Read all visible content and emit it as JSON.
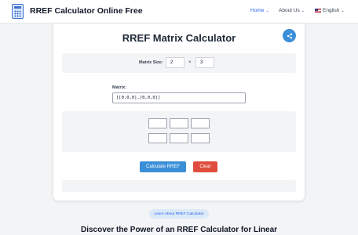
{
  "header": {
    "brand": "RREF Calculator Online Free",
    "brand_icon": "calculator-icon",
    "nav": {
      "home": "Home",
      "about": "About Us",
      "language": "English"
    }
  },
  "calculator": {
    "title": "RREF Matrix Calculator",
    "share_icon": "share-icon",
    "size_label": "Matrix Size:",
    "rows": "2",
    "times": "×",
    "cols": "3",
    "matrix_label": "Matrix:",
    "matrix_value": "[[0,0,0],[0,0,0]]",
    "calculate_label": "Calculate RREF",
    "clear_label": "Clear"
  },
  "learn_link": "Learn About RREF Calculator",
  "section_heading": "Discover the Power of an RREF Calculator for Linear",
  "colors": {
    "accent": "#3b8fd9",
    "danger": "#e04d3e",
    "link": "#2563eb"
  }
}
